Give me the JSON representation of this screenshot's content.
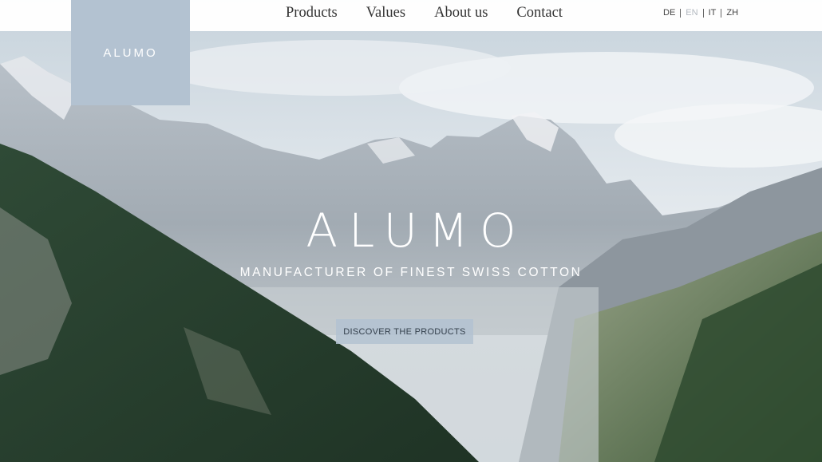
{
  "brand": {
    "logo_text": "ALUMO"
  },
  "nav": {
    "items": [
      "Products",
      "Values",
      "About us",
      "Contact"
    ]
  },
  "languages": {
    "items": [
      "DE",
      "EN",
      "IT",
      "ZH"
    ],
    "active": "EN"
  },
  "hero": {
    "title": "ALUMO",
    "subtitle": "MANUFACTURER OF FINEST SWISS COTTON",
    "cta_label": "DISCOVER THE PRODUCTS"
  },
  "colors": {
    "accent": "#b3c2d1",
    "text": "#333333"
  }
}
